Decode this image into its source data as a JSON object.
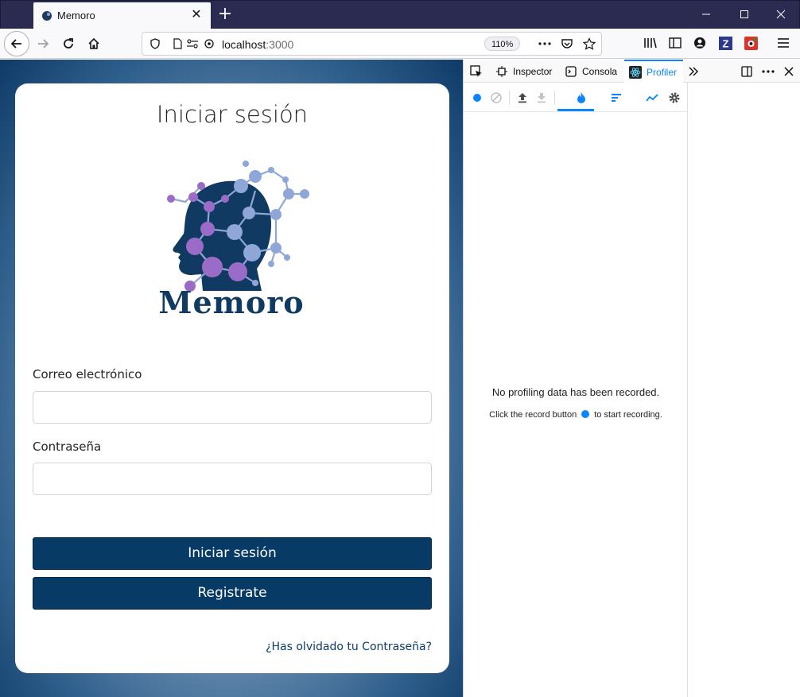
{
  "browser": {
    "tab_title": "Memoro",
    "url_host": "localhost",
    "url_port": ":3000",
    "zoom": "110%"
  },
  "app": {
    "title": "Iniciar sesión",
    "logo_text": "Memoro",
    "email_label": "Correo electrónico",
    "email_value": "",
    "password_label": "Contraseña",
    "password_value": "",
    "login_button": "Iniciar sesión",
    "register_button": "Registrate",
    "forgot_link": "¿Has olvidado tu Contraseña?"
  },
  "devtools": {
    "tabs": [
      {
        "label": "Inspector",
        "icon": "inspector-icon"
      },
      {
        "label": "Consola",
        "icon": "console-icon"
      },
      {
        "label": "Profiler",
        "icon": "react-icon"
      }
    ],
    "empty_message": "No profiling data has been recorded.",
    "hint_before": "Click the record button",
    "hint_after": "to start recording."
  },
  "colors": {
    "primary": "#083a66",
    "accent": "#0a84ff",
    "tabstrip": "#2b2a50"
  }
}
